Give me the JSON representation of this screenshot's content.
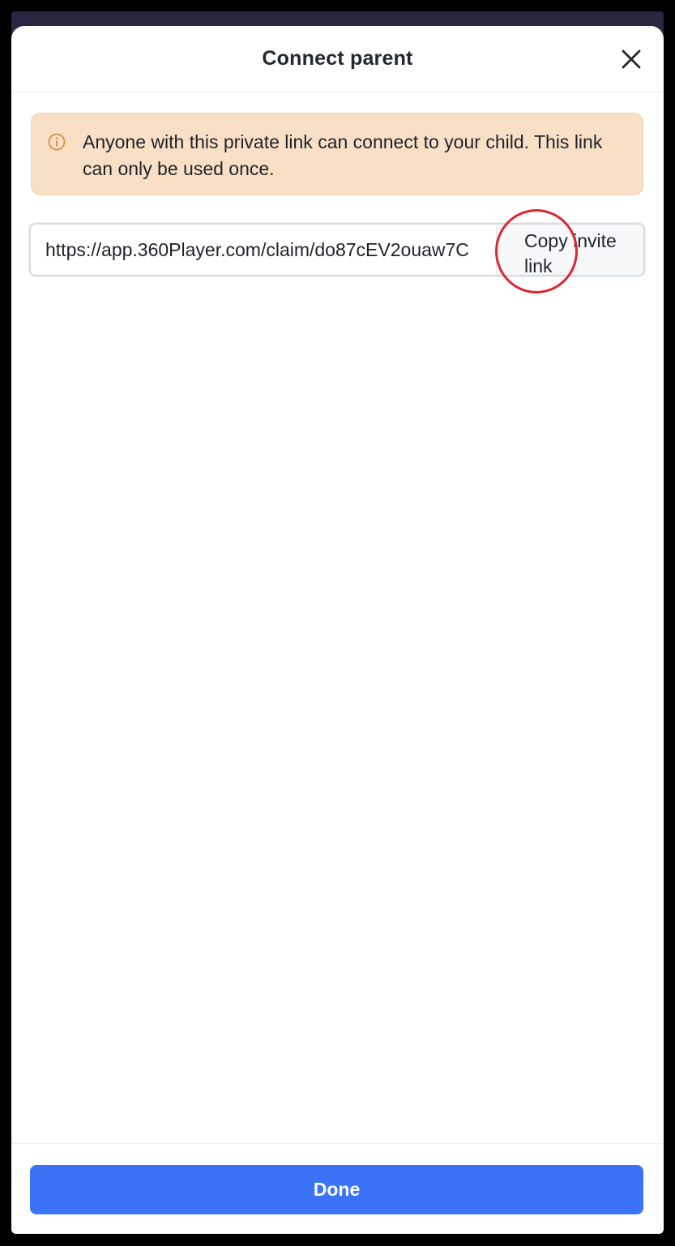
{
  "dialog": {
    "title": "Connect parent",
    "close_icon": "close-icon"
  },
  "alert": {
    "icon": "info-circle-icon",
    "text": "Anyone with this private link can connect to your child. This link can only be used once.",
    "color": "#f9dfc6",
    "icon_color": "#e08a3c"
  },
  "invite": {
    "url": "https://app.360Player.com/claim/do87cEV2ouaw7C",
    "copy_label": "Copy invite link"
  },
  "annotation": {
    "type": "circle",
    "color": "#d9282f"
  },
  "footer": {
    "done_label": "Done",
    "accent": "#3a73f5"
  }
}
